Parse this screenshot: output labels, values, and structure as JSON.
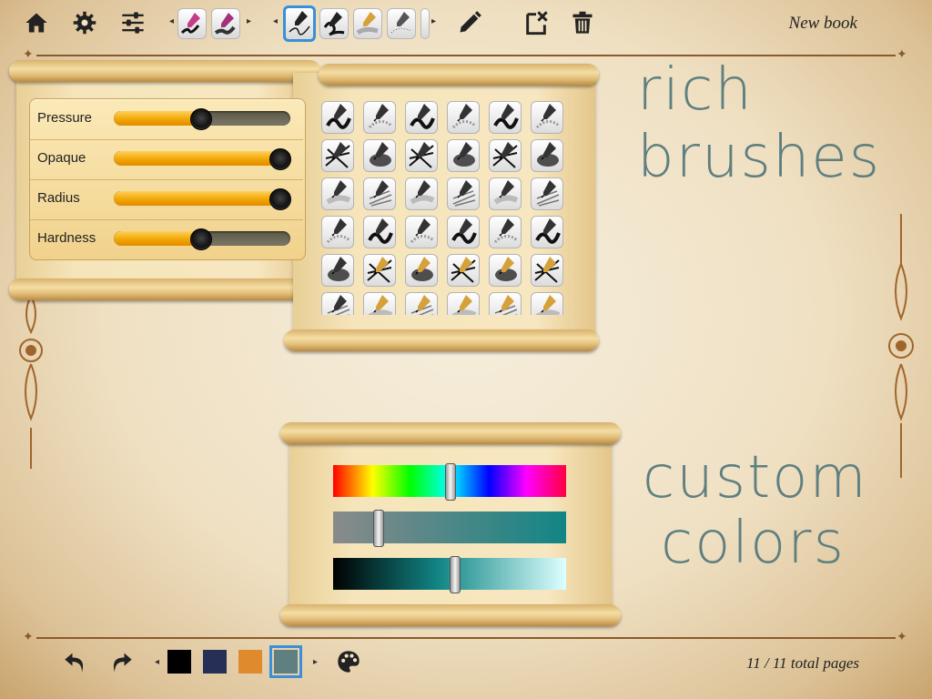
{
  "toolbar": {
    "icons": [
      "home-icon",
      "gear-icon",
      "sliders-icon",
      "pencil-icon",
      "clear-page-icon",
      "trash-icon"
    ],
    "recent_brushes_count": 2,
    "brushes_visible": 5,
    "selected_brush_index": 0,
    "book_title": "New book"
  },
  "brush_settings": {
    "sliders": [
      {
        "label": "Pressure",
        "value": 0.49
      },
      {
        "label": "Opaque",
        "value": 0.94
      },
      {
        "label": "Radius",
        "value": 0.94
      },
      {
        "label": "Hardness",
        "value": 0.49
      }
    ]
  },
  "brush_library": {
    "rows": 6,
    "columns": 6
  },
  "color_picker": {
    "hue_value": 0.5,
    "saturation_value": 0.19,
    "brightness_value": 0.52,
    "accent_color": "#128585"
  },
  "annotations": {
    "top": "rich brushes",
    "middle_1": "custom",
    "middle_2": "colors"
  },
  "bottom_bar": {
    "icons": [
      "undo-icon",
      "redo-icon",
      "palette-icon"
    ],
    "swatches": [
      {
        "color": "#000000"
      },
      {
        "color": "#263056"
      },
      {
        "color": "#e08a2e"
      },
      {
        "color": "#5f7f80",
        "selected": true
      }
    ],
    "page_info": "11 / 11 total pages"
  }
}
